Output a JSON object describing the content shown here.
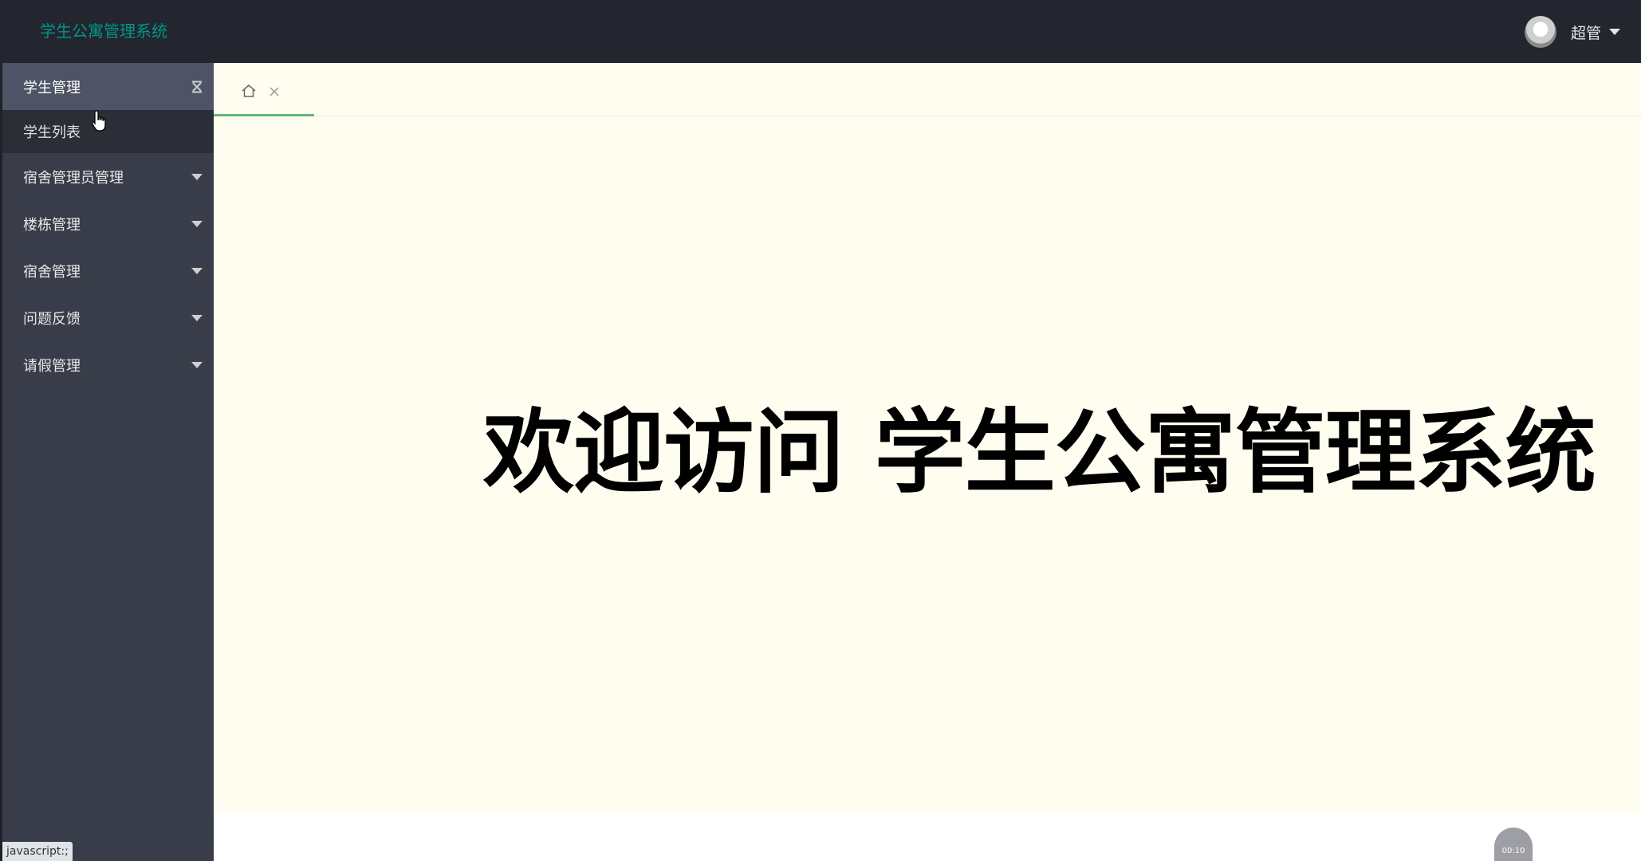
{
  "header": {
    "app_title": "学生公寓管理系统",
    "user_name": "超管"
  },
  "sidebar": {
    "items": [
      {
        "label": "学生管理",
        "expanded": true,
        "children": [
          {
            "label": "学生列表"
          }
        ]
      },
      {
        "label": "宿舍管理员管理",
        "expanded": false
      },
      {
        "label": "楼栋管理",
        "expanded": false
      },
      {
        "label": "宿舍管理",
        "expanded": false
      },
      {
        "label": "问题反馈",
        "expanded": false
      },
      {
        "label": "请假管理",
        "expanded": false
      }
    ]
  },
  "tabs": [
    {
      "icon": "home-icon",
      "closable": true,
      "active": true
    }
  ],
  "main": {
    "welcome": "欢迎访问 学生公寓管理系统"
  },
  "status_bar": {
    "text": "javascript:;"
  },
  "recorder": {
    "time": "00:10"
  },
  "colors": {
    "header_bg": "#23262e",
    "sidebar_bg": "#393d49",
    "active_item_bg": "#4e5465",
    "submenu_bg": "#2b2e37",
    "logo_accent": "#009688",
    "tab_underline": "#5fb878",
    "content_bg": "#fffdf0"
  }
}
